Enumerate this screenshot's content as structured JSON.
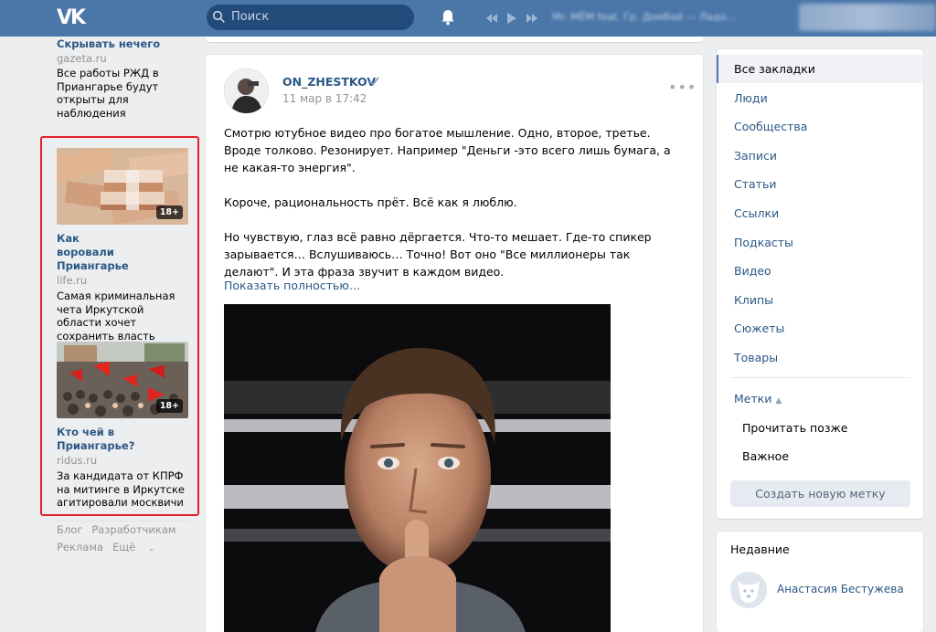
{
  "header": {
    "logo": "VK",
    "search_placeholder": "Поиск",
    "track": "Mr. MЁМ feat. Гр. Домбай — Ладо..."
  },
  "left": {
    "ad0": {
      "title": "Скрывать нечего",
      "source": "gazeta.ru",
      "text": "Все работы РЖД в Приангарье будут открыты для наблюдения"
    },
    "ad1": {
      "title": "Как воровали Приангарье",
      "source": "life.ru",
      "text": "Самая криминальная чета Иркутской области хочет сохранить власть",
      "badge": "18+"
    },
    "ad2": {
      "title": "Кто чей в Приангарье?",
      "source": "ridus.ru",
      "text": "За кандидата от КПРФ на митинге в Иркутске агитировали москвичи",
      "badge": "18+"
    },
    "footer": {
      "blog": "Блог",
      "devs": "Разработчикам",
      "ads": "Реклама",
      "more": "Ещё"
    }
  },
  "post": {
    "author": "ON_ZHESTKOV",
    "date": "11 мар в 17:42",
    "dots": "•••",
    "paragraphs": [
      "Смотрю ютубное видео про богатое мышление. Одно, второе, третье. Вроде толково. Резонирует. Например \"Деньги -это всего лишь бумага, а не какая-то энергия\".",
      "Короче, рациональность прёт. Всё как я люблю.",
      "Но чувствую, глаз всё равно дёргается. Что-то мешает. Где-то спикер зарывается… Вслушиваюсь… Точно! Вот оно \"Все миллионеры так делают\". И эта фраза звучит в каждом видео."
    ],
    "show_more": "Показать полностью…"
  },
  "rmenu": {
    "items": [
      "Все закладки",
      "Люди",
      "Сообщества",
      "Записи",
      "Статьи",
      "Ссылки",
      "Подкасты",
      "Видео",
      "Клипы",
      "Сюжеты",
      "Товары"
    ],
    "tags_label": "Метки",
    "tags": [
      "Прочитать позже",
      "Важное"
    ],
    "new_tag": "Создать новую метку"
  },
  "recent": {
    "title": "Недавние",
    "name": "Анастасия Бестужева"
  },
  "colors": {
    "header": "#4a76a8",
    "link": "#2a5885",
    "highlight": "#e3212d"
  }
}
